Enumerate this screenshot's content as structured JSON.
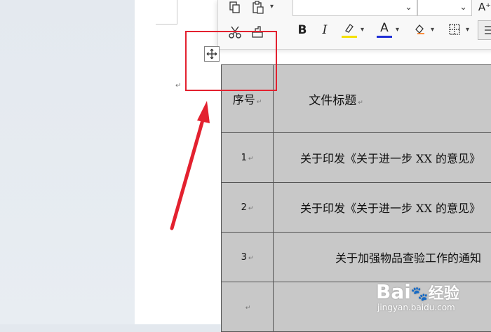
{
  "table": {
    "header": {
      "seq": "序号",
      "title": "文件标题"
    },
    "rows": [
      {
        "seq": "1",
        "title": "关于印发《关于进一步 XX 的意见》"
      },
      {
        "seq": "2",
        "title": "关于印发《关于进一步 XX 的意见》"
      },
      {
        "seq": "3",
        "title": "关于加强物品查验工作的通知"
      },
      {
        "seq": "",
        "title": ""
      }
    ]
  },
  "icons": {
    "copy": "copy-icon",
    "paste": "paste-icon",
    "cut": "cut-icon",
    "format_painter": "format-painter-icon",
    "bold": "bold-icon",
    "italic": "italic-icon",
    "highlight": "highlight-icon",
    "font_color": "font-color-icon",
    "clear_format": "clear-format-icon",
    "border": "border-icon",
    "align": "align-icon",
    "grow_font": "grow-font-icon",
    "move_handle": "table-move-icon"
  },
  "toolbar": {
    "bold": "B",
    "italic": "I",
    "font_color_letter": "A",
    "grow_font": "A⁺"
  },
  "colors": {
    "highlight": "#f5e000",
    "font_color": "#1f2fd6",
    "annotation": "#e3212f",
    "cell_bg": "#c8c8c8"
  },
  "watermark": {
    "logo": "Bai",
    "logo2": "经验",
    "url": "jingyan.baidu.com"
  },
  "marks": {
    "para": "↵"
  }
}
